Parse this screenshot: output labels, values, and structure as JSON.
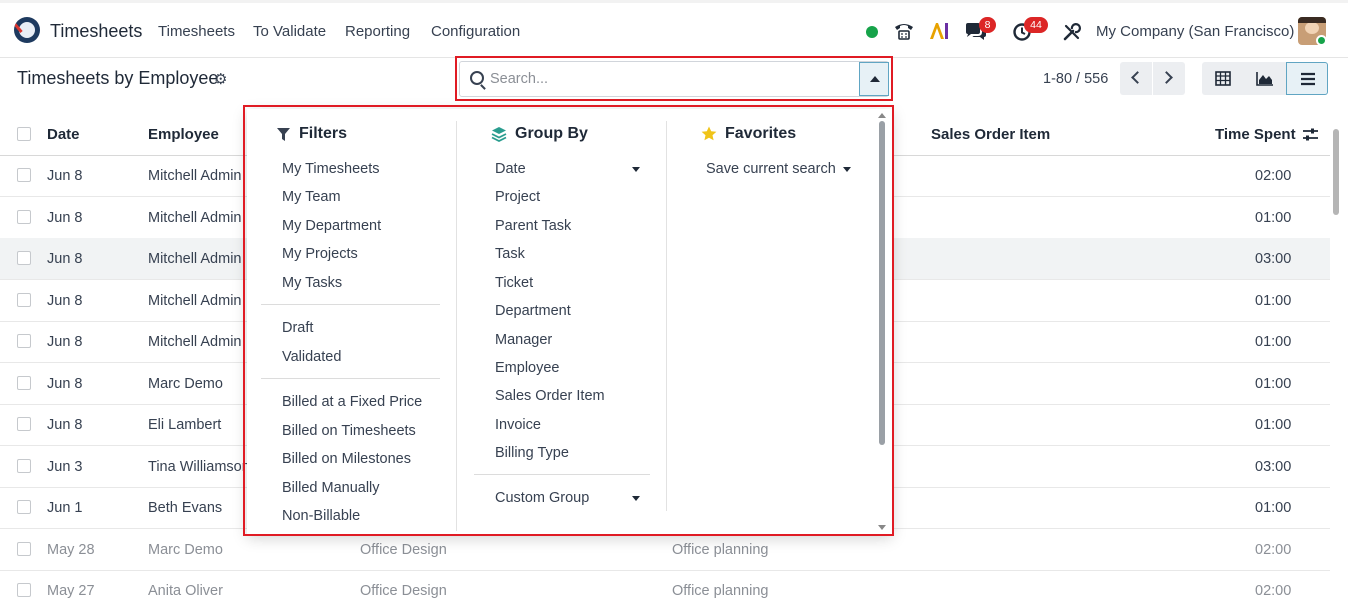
{
  "navbar": {
    "app_name": "Timesheets",
    "menus": [
      "Timesheets",
      "To Validate",
      "Reporting",
      "Configuration"
    ],
    "messages_badge": "8",
    "activities_badge": "44",
    "company": "My Company (San Francisco)"
  },
  "control": {
    "title": "Timesheets by Employee",
    "search_placeholder": "Search...",
    "pager": "1-80 / 556"
  },
  "table": {
    "headers": {
      "date": "Date",
      "employee": "Employee",
      "sales_order_item": "Sales Order Item",
      "time_spent": "Time Spent"
    },
    "rows": [
      {
        "date": "Jun 8",
        "employee": "Mitchell Admin",
        "project": "",
        "task": "",
        "time": "02:00"
      },
      {
        "date": "Jun 8",
        "employee": "Mitchell Admin",
        "project": "",
        "task": "",
        "time": "01:00"
      },
      {
        "date": "Jun 8",
        "employee": "Mitchell Admin",
        "project": "",
        "task": "",
        "time": "03:00"
      },
      {
        "date": "Jun 8",
        "employee": "Mitchell Admin",
        "project": "",
        "task": "",
        "time": "01:00"
      },
      {
        "date": "Jun 8",
        "employee": "Mitchell Admin",
        "project": "",
        "task": "",
        "time": "01:00"
      },
      {
        "date": "Jun 8",
        "employee": "Marc Demo",
        "project": "",
        "task": "",
        "time": "01:00"
      },
      {
        "date": "Jun 8",
        "employee": "Eli Lambert",
        "project": "",
        "task": "",
        "time": "01:00"
      },
      {
        "date": "Jun 3",
        "employee": "Tina Williamson",
        "project": "",
        "task": "",
        "time": "03:00"
      },
      {
        "date": "Jun 1",
        "employee": "Beth Evans",
        "project": "",
        "task": "",
        "time": "01:00"
      },
      {
        "date": "May 28",
        "employee": "Marc Demo",
        "project": "Office Design",
        "task": "Office planning",
        "time": "02:00"
      },
      {
        "date": "May 27",
        "employee": "Anita Oliver",
        "project": "Office Design",
        "task": "Office planning",
        "time": "02:00"
      }
    ]
  },
  "dropdown": {
    "filters": {
      "title": "Filters",
      "group1": [
        "My Timesheets",
        "My Team",
        "My Department",
        "My Projects",
        "My Tasks"
      ],
      "group2": [
        "Draft",
        "Validated"
      ],
      "group3": [
        "Billed at a Fixed Price",
        "Billed on Timesheets",
        "Billed on Milestones",
        "Billed Manually",
        "Non-Billable"
      ]
    },
    "group_by": {
      "title": "Group By",
      "items": [
        "Date",
        "Project",
        "Parent Task",
        "Task",
        "Ticket",
        "Department",
        "Manager",
        "Employee",
        "Sales Order Item",
        "Invoice",
        "Billing Type"
      ],
      "custom": "Custom Group"
    },
    "favorites": {
      "title": "Favorites",
      "save": "Save current search"
    }
  },
  "colors": {
    "highlight_box": "#e01b24",
    "status_online": "#16a34a",
    "badge": "#dc2626"
  }
}
